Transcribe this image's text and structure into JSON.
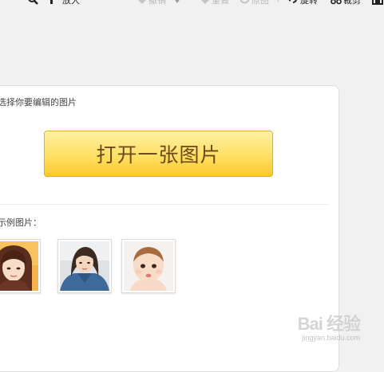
{
  "toolbar": {
    "zoom_label": "放大",
    "undo_label": "撤销",
    "redo_label": "重做",
    "original_label": "原图",
    "rotate_label": "旋转",
    "crop_label": "裁剪"
  },
  "main": {
    "prompt": "选择你要编辑的图片",
    "open_button": "打开一张图片",
    "examples_label": "示例图片：",
    "examples": [
      {
        "name": "woman-with-bangs"
      },
      {
        "name": "woman-in-denim"
      },
      {
        "name": "baby"
      }
    ]
  },
  "watermark": {
    "brand": "Bai 经验",
    "url": "jingyan.baidu.com"
  },
  "colors": {
    "button_top": "#fff0a3",
    "button_bottom": "#fdc92d",
    "button_text": "#6b4a16",
    "panel_bg": "#ffffff",
    "page_bg": "#f1f1f1"
  }
}
